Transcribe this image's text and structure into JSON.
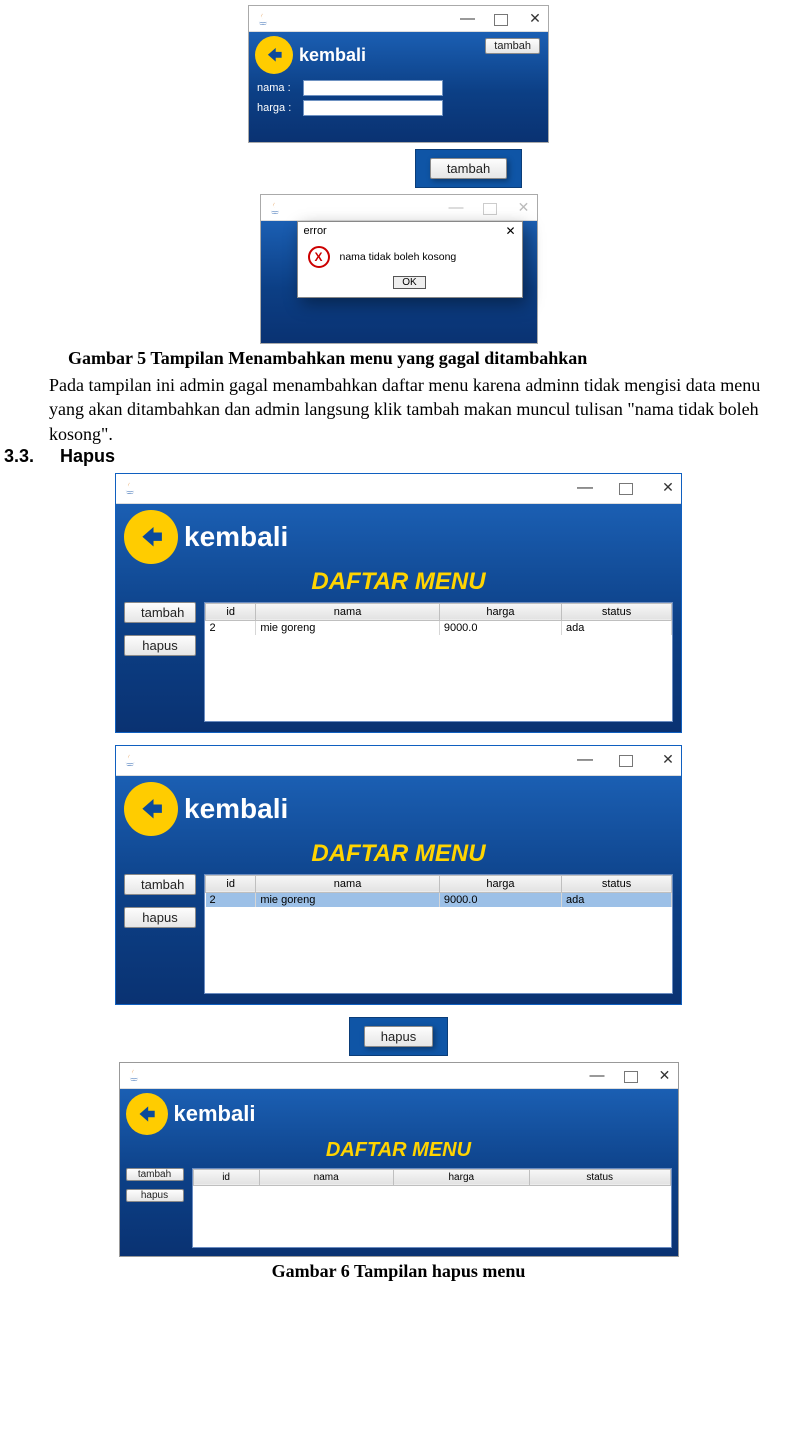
{
  "captions": {
    "gambar5": "Gambar 5 Tampilan Menambahkan menu  yang gagal ditambahkan",
    "gambar6": "Gambar 6 Tampilan hapus menu"
  },
  "paragraph": "Pada tampilan ini admin gagal menambahkan daftar menu karena adminn tidak mengisi data menu yang akan ditambahkan dan admin langsung klik tambah makan muncul tulisan \"nama tidak boleh kosong\".",
  "section": {
    "number": "3.3.",
    "title": "Hapus"
  },
  "common": {
    "kembali": "kembali",
    "tambah": "tambah",
    "hapus": "hapus",
    "ok": "OK",
    "daftar_menu": "DAFTAR MENU"
  },
  "form1": {
    "label_nama": "nama :",
    "label_harga": "harga :"
  },
  "error_dialog": {
    "title": "error",
    "message": "nama tidak boleh kosong"
  },
  "table": {
    "headers": {
      "id": "id",
      "nama": "nama",
      "harga": "harga",
      "status": "status"
    },
    "row": {
      "id": "2",
      "nama": "mie goreng",
      "harga": "9000.0",
      "status": "ada"
    }
  }
}
